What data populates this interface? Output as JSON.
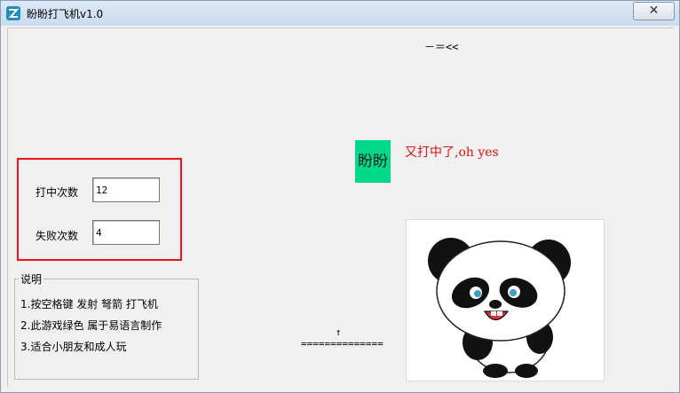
{
  "window": {
    "title": "盼盼打飞机v1.0",
    "close_label": "✕"
  },
  "game": {
    "plane_text": "－＝<<",
    "target_label": "盼盼",
    "hit_message": "又打中了,oh yes",
    "shooter_arrow": "↑",
    "shooter_base": "=============="
  },
  "stats": {
    "hits_label": "打中次数",
    "hits_value": "12",
    "misses_label": "失败次数",
    "misses_value": "4"
  },
  "instructions": {
    "title": "说明",
    "lines": [
      "1.按空格键 发射 弩箭 打飞机",
      "2.此游戏绿色 属于易语言制作",
      "3.适合小朋友和成人玩"
    ]
  },
  "colors": {
    "target_bg": "#00d98a",
    "hit_message": "#e01010",
    "highlight_border": "#e8141c"
  }
}
